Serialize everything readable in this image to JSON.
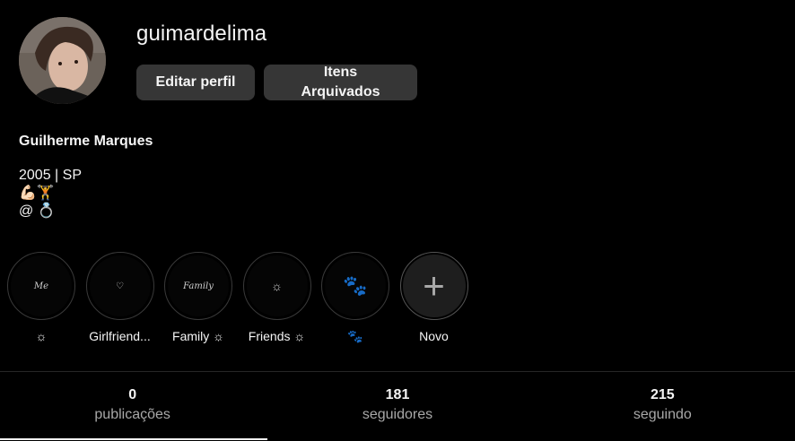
{
  "profile": {
    "username": "guimardelima",
    "full_name": "Guilherme Marques",
    "bio_lines": [
      "2005 | SP",
      "💪🏻🏋️",
      "@ 💍"
    ]
  },
  "buttons": {
    "edit_label": "Editar perfil",
    "archive_label": "Itens Arquivados"
  },
  "highlights": [
    {
      "label": "☼",
      "cover_text": "Me"
    },
    {
      "label": "Girlfriend...",
      "cover_text": "♡"
    },
    {
      "label": "Family ☼",
      "cover_text": "Family"
    },
    {
      "label": "Friends ☼",
      "cover_text": "☼"
    },
    {
      "label": "🐾",
      "cover_text": "🐾"
    },
    {
      "label": "Novo",
      "cover_text": "+"
    }
  ],
  "stats": [
    {
      "value": "0",
      "label": "publicações"
    },
    {
      "value": "181",
      "label": "seguidores"
    },
    {
      "value": "215",
      "label": "seguindo"
    }
  ],
  "colors": {
    "background": "#000000",
    "button_bg": "#363636",
    "muted_text": "#a8a8a8",
    "text": "#f5f5f5"
  }
}
